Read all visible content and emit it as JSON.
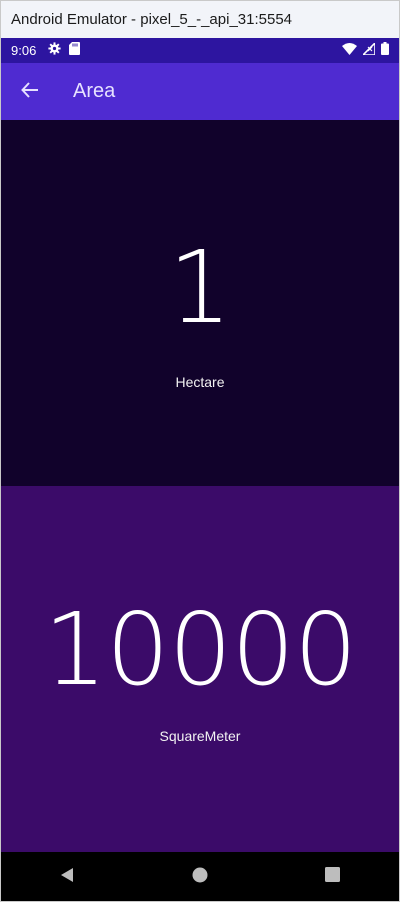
{
  "window": {
    "title": "Android Emulator - pixel_5_-_api_31:5554"
  },
  "status_bar": {
    "time": "9:06",
    "icons_left": [
      "gear-icon",
      "sd-card-icon"
    ],
    "icons_right": [
      "wifi-icon",
      "signal-icon",
      "battery-icon"
    ]
  },
  "app_bar": {
    "title": "Area",
    "back_icon": "arrow-left-icon",
    "color": "#4f2bd1"
  },
  "panels": [
    {
      "value": "1",
      "unit": "Hectare",
      "background": "#11022b"
    },
    {
      "value": "10000",
      "unit": "SquareMeter",
      "background": "#3b0b69"
    }
  ],
  "nav_bar": {
    "buttons": [
      "back-triangle-icon",
      "home-circle-icon",
      "recents-square-icon"
    ]
  }
}
